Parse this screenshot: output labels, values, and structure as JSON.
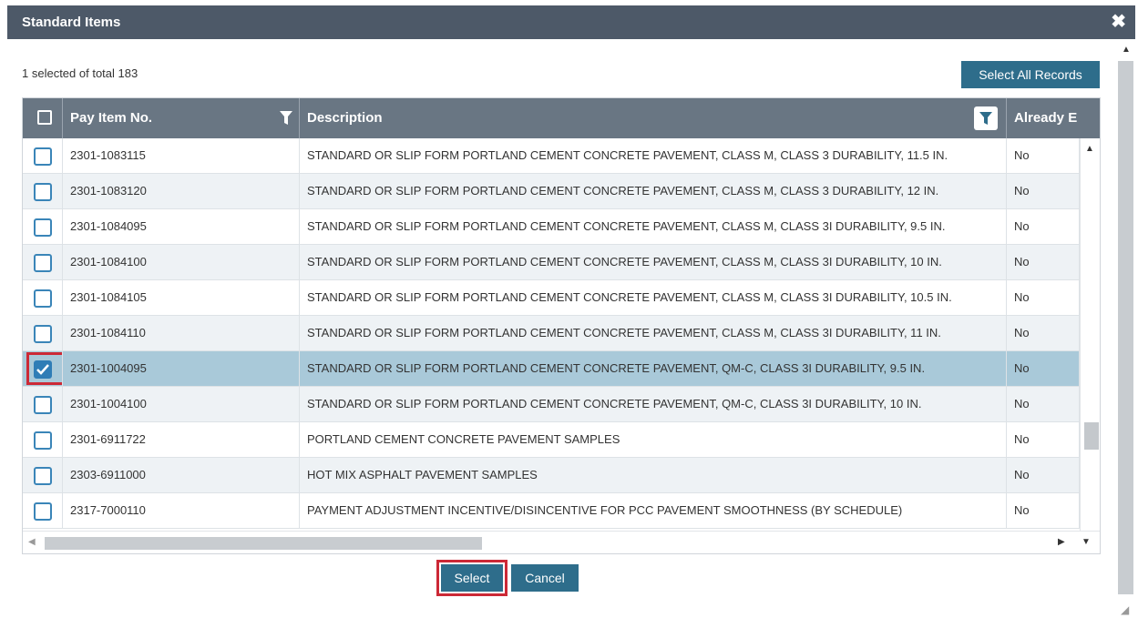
{
  "dialog": {
    "title": "Standard Items",
    "close_icon": "✖"
  },
  "toolbar": {
    "count_text": "1 selected of total 183",
    "select_all_label": "Select All Records"
  },
  "grid": {
    "columns": {
      "pay_item": "Pay Item No.",
      "description": "Description",
      "already": "Already E"
    },
    "rows": [
      {
        "pay_item": "2301-1083115",
        "description": "STANDARD OR SLIP FORM PORTLAND CEMENT CONCRETE PAVEMENT, CLASS M, CLASS 3 DURABILITY, 11.5 IN.",
        "already": "No",
        "checked": false
      },
      {
        "pay_item": "2301-1083120",
        "description": "STANDARD OR SLIP FORM PORTLAND CEMENT CONCRETE PAVEMENT, CLASS M, CLASS 3 DURABILITY, 12 IN.",
        "already": "No",
        "checked": false
      },
      {
        "pay_item": "2301-1084095",
        "description": "STANDARD OR SLIP FORM PORTLAND CEMENT CONCRETE PAVEMENT, CLASS M, CLASS 3I DURABILITY, 9.5 IN.",
        "already": "No",
        "checked": false
      },
      {
        "pay_item": "2301-1084100",
        "description": "STANDARD OR SLIP FORM PORTLAND CEMENT CONCRETE PAVEMENT, CLASS M, CLASS 3I DURABILITY, 10 IN.",
        "already": "No",
        "checked": false
      },
      {
        "pay_item": "2301-1084105",
        "description": "STANDARD OR SLIP FORM PORTLAND CEMENT CONCRETE PAVEMENT, CLASS M, CLASS 3I DURABILITY, 10.5 IN.",
        "already": "No",
        "checked": false
      },
      {
        "pay_item": "2301-1084110",
        "description": "STANDARD OR SLIP FORM PORTLAND CEMENT CONCRETE PAVEMENT, CLASS M, CLASS 3I DURABILITY, 11 IN.",
        "already": "No",
        "checked": false
      },
      {
        "pay_item": "2301-1004095",
        "description": "STANDARD OR SLIP FORM PORTLAND CEMENT CONCRETE PAVEMENT, QM-C, CLASS 3I DURABILITY, 9.5 IN.",
        "already": "No",
        "checked": true
      },
      {
        "pay_item": "2301-1004100",
        "description": "STANDARD OR SLIP FORM PORTLAND CEMENT CONCRETE PAVEMENT, QM-C, CLASS 3I DURABILITY, 10 IN.",
        "already": "No",
        "checked": false
      },
      {
        "pay_item": "2301-6911722",
        "description": "PORTLAND CEMENT CONCRETE PAVEMENT SAMPLES",
        "already": "No",
        "checked": false
      },
      {
        "pay_item": "2303-6911000",
        "description": "HOT MIX ASPHALT PAVEMENT SAMPLES",
        "already": "No",
        "checked": false
      },
      {
        "pay_item": "2317-7000110",
        "description": "PAYMENT ADJUSTMENT INCENTIVE/DISINCENTIVE FOR PCC PAVEMENT SMOOTHNESS (BY SCHEDULE)",
        "already": "No",
        "checked": false
      }
    ]
  },
  "footer": {
    "select_label": "Select",
    "cancel_label": "Cancel"
  },
  "colors": {
    "title_bar": "#4d5968",
    "header": "#697683",
    "button": "#2e6d8b",
    "selected_row": "#a9c9d9",
    "highlight": "#cc2936"
  }
}
